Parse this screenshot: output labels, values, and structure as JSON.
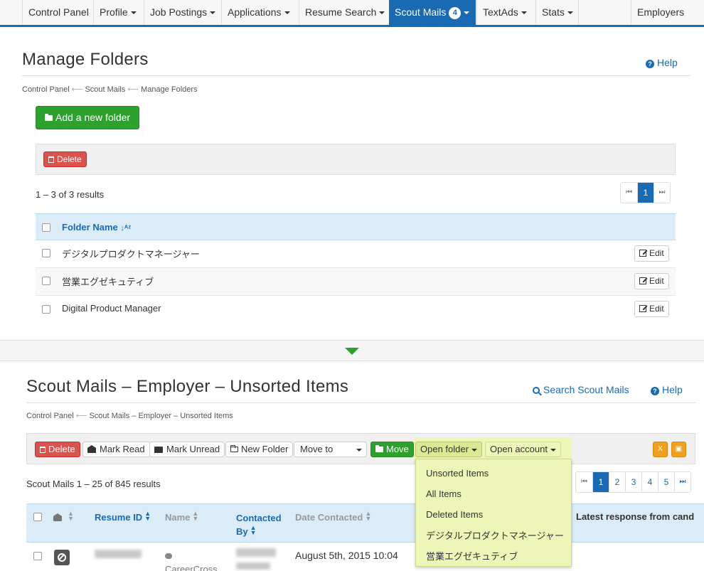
{
  "nav": {
    "items": [
      {
        "label": "Control Panel",
        "dropdown": false
      },
      {
        "label": "Profile",
        "dropdown": true
      },
      {
        "label": "Job Postings",
        "dropdown": true
      },
      {
        "label": "Applications",
        "dropdown": true
      },
      {
        "label": "Resume Search",
        "dropdown": true
      },
      {
        "label": "Scout Mails",
        "dropdown": true,
        "badge": "4",
        "active": true
      },
      {
        "label": "TextAds",
        "dropdown": true
      },
      {
        "label": "Stats",
        "dropdown": true
      }
    ],
    "right": "Employers"
  },
  "folders": {
    "title": "Manage Folders",
    "help": "Help",
    "breadcrumb": [
      "Control Panel",
      "Scout Mails",
      "Manage Folders"
    ],
    "add_button": "Add a new folder",
    "delete_button": "Delete",
    "results": "1 – 3 of 3 results",
    "pager": {
      "current": "1"
    },
    "column": "Folder Name",
    "rows": [
      {
        "name": "デジタルプロダクトマネージャー",
        "edit": "Edit"
      },
      {
        "name": "営業エグゼキュティブ",
        "edit": "Edit"
      },
      {
        "name": "Digital Product Manager",
        "edit": "Edit"
      }
    ]
  },
  "mails": {
    "title": "Scout Mails – Employer – Unsorted Items",
    "search_link": "Search Scout Mails",
    "help": "Help",
    "breadcrumb": [
      "Control Panel",
      "Scout Mails – Employer – Unsorted Items"
    ],
    "toolbar": {
      "delete": "Delete",
      "mark_read": "Mark Read",
      "mark_unread": "Mark Unread",
      "new_folder": "New Folder",
      "move_to": "Move to",
      "move": "Move",
      "open_folder": "Open folder",
      "open_account": "Open account"
    },
    "results": "Scout Mails 1 – 25 of 845 results",
    "pager": [
      "1",
      "2",
      "3",
      "4",
      "5"
    ],
    "pager_current": "1",
    "columns": {
      "resume_id": "Resume ID",
      "name": "Name",
      "contacted_by_1": "Contacted",
      "contacted_by_2": "By",
      "date_contacted": "Date Contacted",
      "latest_response": "Latest response from cand"
    },
    "rows": [
      {
        "name_text": "CareerCross",
        "date": "August 5th, 2015 10:04"
      }
    ],
    "folder_menu": [
      "Unsorted Items",
      "All Items",
      "Deleted Items",
      "デジタルプロダクトマネージャー",
      "営業エグゼキュティブ"
    ]
  },
  "colors": {
    "primary": "#1a6ab3",
    "green": "#2ea02e",
    "red": "#d9534f",
    "highlight": "#eef5b8",
    "orange": "#f0a020"
  }
}
